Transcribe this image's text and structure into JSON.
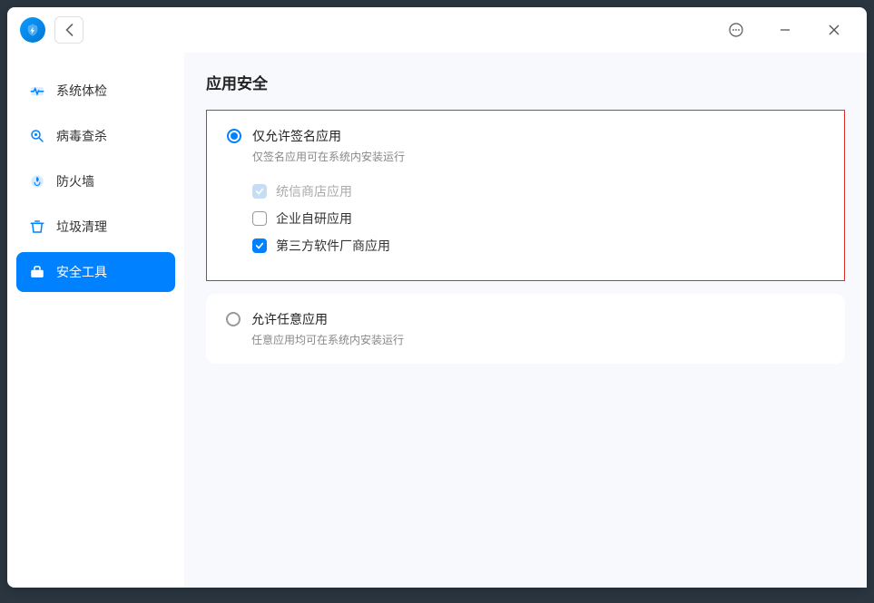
{
  "sidebar": {
    "items": [
      {
        "label": "系统体检",
        "icon": "heartbeat"
      },
      {
        "label": "病毒查杀",
        "icon": "scan"
      },
      {
        "label": "防火墙",
        "icon": "firewall"
      },
      {
        "label": "垃圾清理",
        "icon": "trash"
      },
      {
        "label": "安全工具",
        "icon": "toolbox"
      }
    ],
    "active_index": 4
  },
  "page": {
    "title": "应用安全"
  },
  "options": [
    {
      "title": "仅允许签名应用",
      "desc": "仅签名应用可在系统内安装运行",
      "selected": true,
      "highlighted": true,
      "checkboxes": [
        {
          "label": "统信商店应用",
          "checked": true,
          "disabled": true
        },
        {
          "label": "企业自研应用",
          "checked": false,
          "disabled": false
        },
        {
          "label": "第三方软件厂商应用",
          "checked": true,
          "disabled": false
        }
      ]
    },
    {
      "title": "允许任意应用",
      "desc": "任意应用均可在系统内安装运行",
      "selected": false,
      "highlighted": false
    }
  ]
}
